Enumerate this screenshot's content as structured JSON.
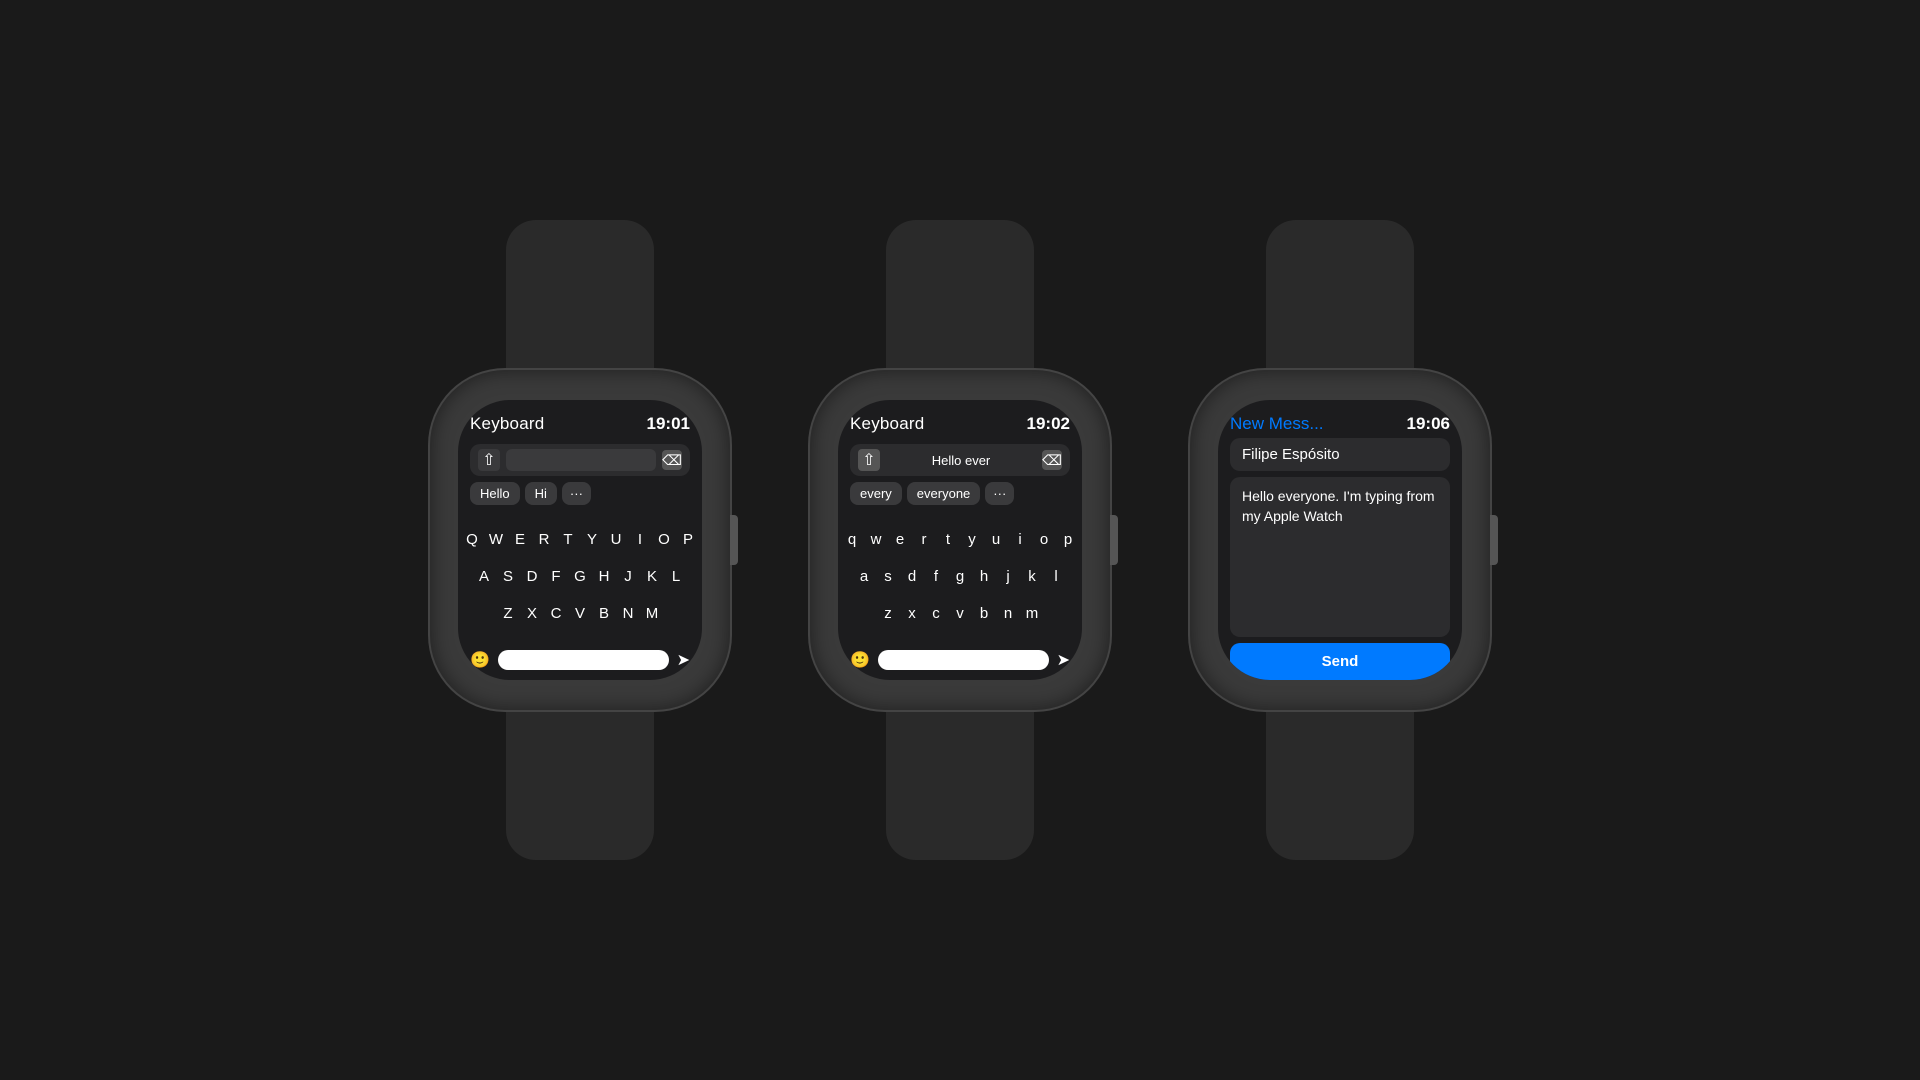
{
  "background": "#1a1a1a",
  "watches": [
    {
      "id": "watch1",
      "screen": {
        "title": "Keyboard",
        "time": "19:01",
        "input_text": "",
        "input_placeholder": "",
        "suggestions": [
          "Hello",
          "Hi",
          "···"
        ],
        "keyboard_rows": [
          [
            "Q",
            "W",
            "E",
            "R",
            "T",
            "Y",
            "U",
            "I",
            "O",
            "P"
          ],
          [
            "A",
            "S",
            "D",
            "F",
            "G",
            "H",
            "J",
            "K",
            "L"
          ],
          [
            "Z",
            "X",
            "C",
            "V",
            "B",
            "N",
            "M"
          ]
        ],
        "has_shift": true,
        "shift_row_prefix": true
      }
    },
    {
      "id": "watch2",
      "screen": {
        "title": "Keyboard",
        "time": "19:02",
        "input_text": "Hello ever",
        "suggestions": [
          "every",
          "everyone",
          "···"
        ],
        "keyboard_rows": [
          [
            "q",
            "w",
            "e",
            "r",
            "t",
            "y",
            "u",
            "i",
            "o",
            "p"
          ],
          [
            "a",
            "s",
            "d",
            "f",
            "g",
            "h",
            "j",
            "k",
            "l"
          ],
          [
            "z",
            "x",
            "c",
            "v",
            "b",
            "n",
            "m"
          ]
        ],
        "has_shift": true
      }
    },
    {
      "id": "watch3",
      "screen": {
        "title": "New Mess...",
        "time": "19:06",
        "contact": "Filipe Espósito",
        "message": "Hello everyone. I'm typing from my Apple Watch",
        "send_label": "Send"
      }
    }
  ]
}
